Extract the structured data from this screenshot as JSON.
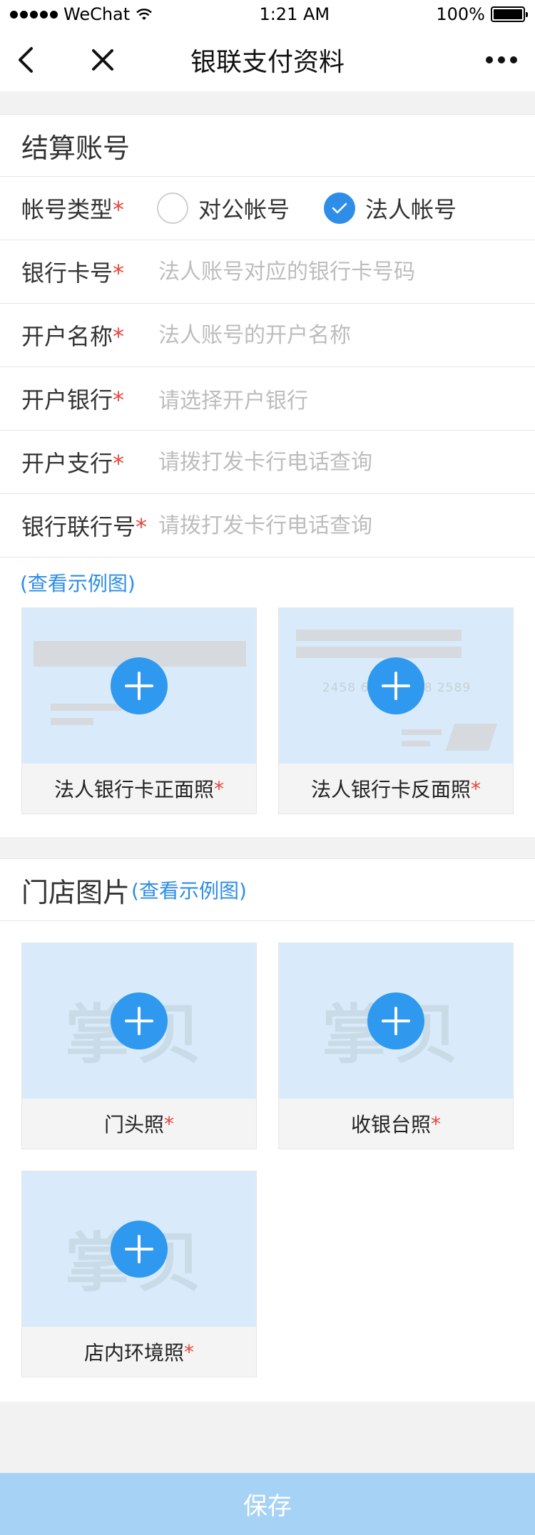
{
  "status_bar": {
    "carrier": "WeChat",
    "time": "1:21 AM",
    "battery": "100%"
  },
  "nav": {
    "title": "银联支付资料"
  },
  "settlement": {
    "title": "结算账号",
    "account_type": {
      "label": "帐号类型",
      "options": [
        "对公帐号",
        "法人帐号"
      ],
      "selected": "法人帐号"
    },
    "fields": [
      {
        "label": "银行卡号",
        "placeholder": "法人账号对应的银行卡号码"
      },
      {
        "label": "开户名称",
        "placeholder": "法人账号的开户名称"
      },
      {
        "label": "开户银行",
        "placeholder": "请选择开户银行"
      },
      {
        "label": "开户支行",
        "placeholder": "请拨打发卡行电话查询"
      },
      {
        "label": "银行联行号",
        "placeholder": "请拨打发卡行电话查询"
      }
    ],
    "example_link": "(查看示例图)",
    "card_front_caption": "法人银行卡正面照",
    "card_back_caption": "法人银行卡反面照",
    "card_number_hint": "2458 6280 1618 2589"
  },
  "store": {
    "title": "门店图片",
    "example_link": "(查看示例图)",
    "photos": [
      "门头照",
      "收银台照",
      "店内环境照"
    ],
    "watermark": "掌贝"
  },
  "required_mark": "*",
  "save_label": "保存"
}
